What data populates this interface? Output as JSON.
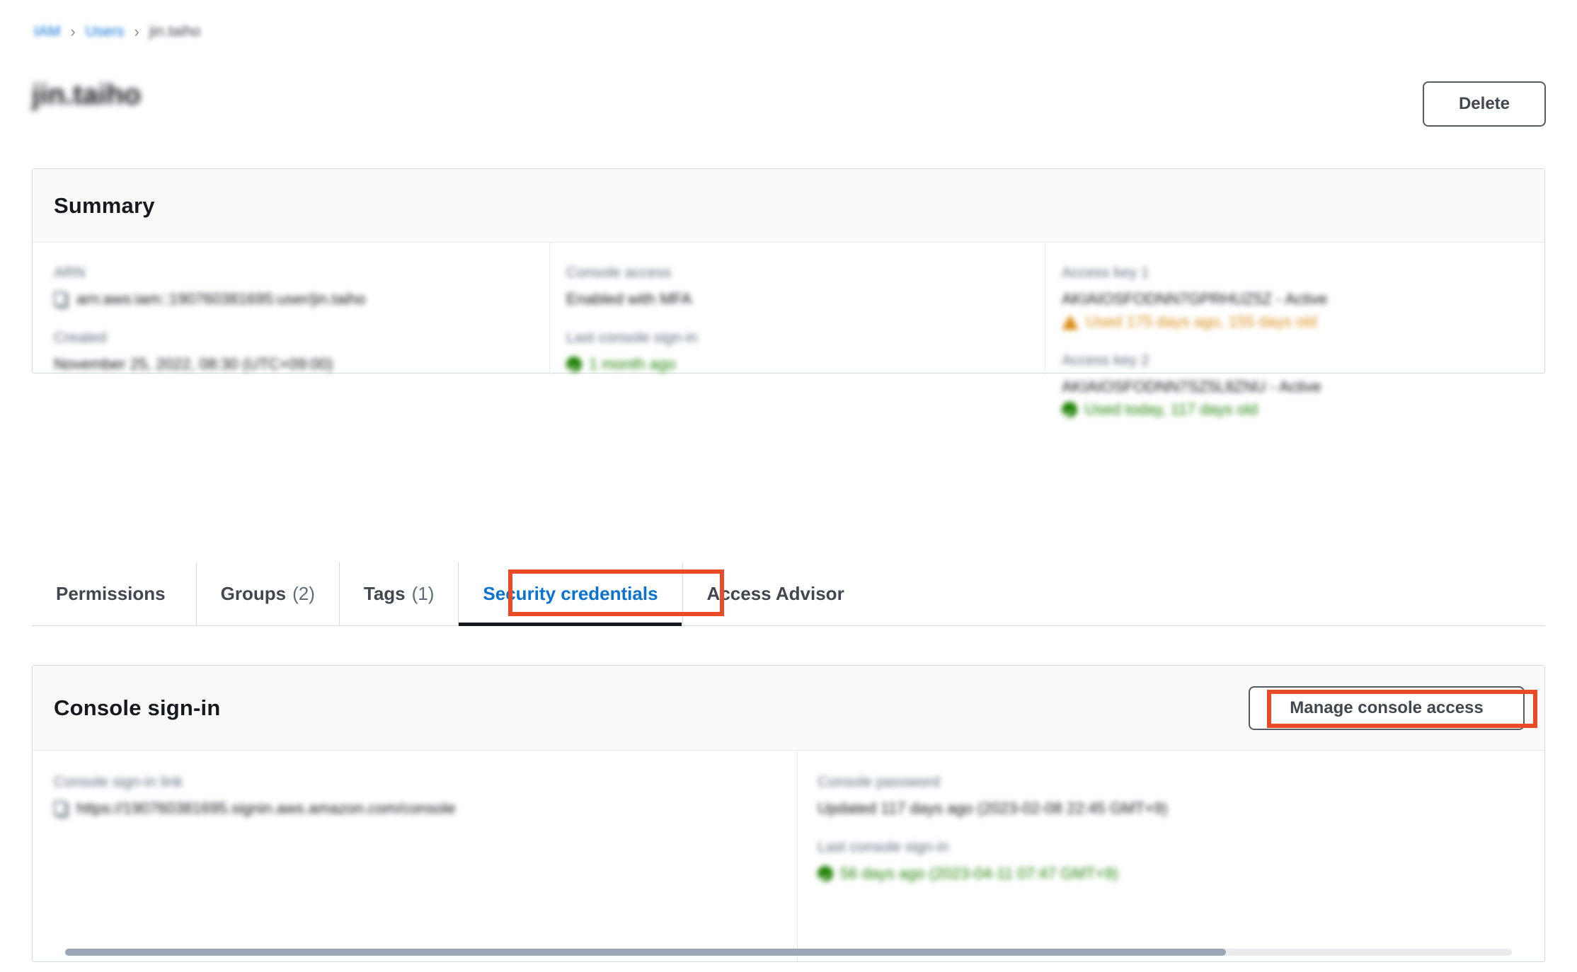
{
  "breadcrumb": {
    "items": [
      {
        "label": "IAM",
        "type": "link"
      },
      {
        "label": "Users",
        "type": "link"
      },
      {
        "label": "jin.taiho",
        "type": "current"
      }
    ],
    "separator": "›"
  },
  "header": {
    "title": "jin.taiho",
    "delete_label": "Delete"
  },
  "summary": {
    "title": "Summary",
    "arn": {
      "label": "ARN",
      "value": "arn:aws:iam::190760381695:user/jin.taiho",
      "copy_icon": "copy-icon"
    },
    "created": {
      "label": "Created",
      "value": "November 25, 2022, 08:30 (UTC+09:00)"
    },
    "console_access": {
      "label": "Console access",
      "value": "Enabled with MFA"
    },
    "last_console_sign_in": {
      "label": "Last console sign-in",
      "value": "1 month ago",
      "status": "ok",
      "status_icon": "check-circle-icon"
    },
    "access_key_1": {
      "label": "Access key 1",
      "value": "AKIAIOSFODNN7GPRHUZ5Z - Active",
      "usage": "Used 175 days ago, 155 days old",
      "status": "warn",
      "status_icon": "warning-triangle-icon"
    },
    "access_key_2": {
      "label": "Access key 2",
      "value": "AKIAIOSFODNN7SZ5L8ZNU - Active",
      "usage": "Used today, 117 days old",
      "status": "ok",
      "status_icon": "check-circle-icon"
    }
  },
  "tabs": [
    {
      "label": "Permissions",
      "count": "",
      "active": false
    },
    {
      "label": "Groups",
      "count": "(2)",
      "active": false
    },
    {
      "label": "Tags",
      "count": "(1)",
      "active": false
    },
    {
      "label": "Security credentials",
      "count": "",
      "active": true
    },
    {
      "label": "Access Advisor",
      "count": "",
      "active": false
    }
  ],
  "console_signin": {
    "title": "Console sign-in",
    "manage_label": "Manage console access",
    "signin_link": {
      "label": "Console sign-in link",
      "value": "https://190760381695.signin.aws.amazon.com/console",
      "copy_icon": "copy-icon"
    },
    "password": {
      "label": "Console password",
      "value": "Updated 117 days ago (2023-02-08 22:45 GMT+9)"
    },
    "last_sign_in": {
      "label": "Last console sign-in",
      "value": "56 days ago (2023-04-11 07:47 GMT+9)",
      "status": "ok",
      "status_icon": "check-circle-icon"
    }
  },
  "colors": {
    "link": "#0972d3",
    "annotation": "#eb4a26",
    "success": "#1d8102",
    "warning": "#d88b14",
    "text": "#16191f",
    "label": "#5f6b7a",
    "border": "#d5dbdb"
  }
}
